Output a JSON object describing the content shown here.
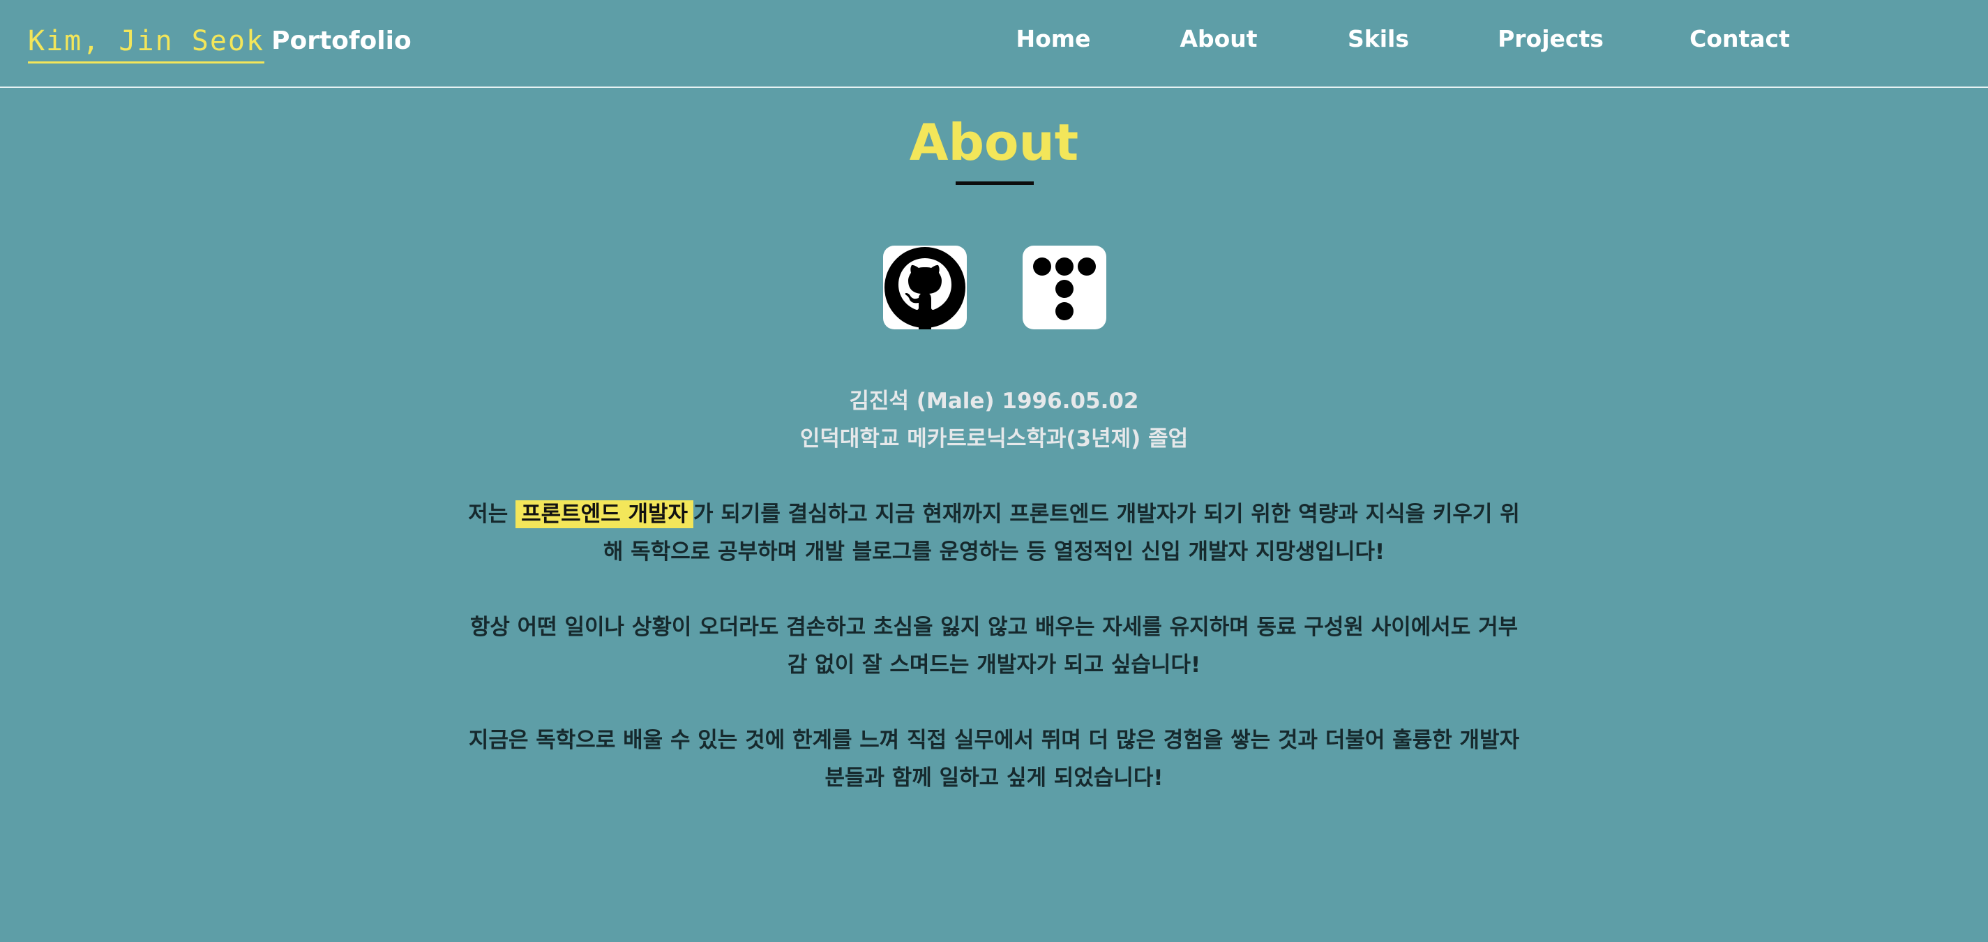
{
  "header": {
    "brand_name": "Kim, Jin Seok",
    "brand_sub": "Portofolio"
  },
  "nav": {
    "items": [
      {
        "label": "Home"
      },
      {
        "label": "About"
      },
      {
        "label": "Skils"
      },
      {
        "label": "Projects"
      },
      {
        "label": "Contact"
      }
    ]
  },
  "about": {
    "title": "About",
    "links": {
      "github_icon": "github-icon",
      "tistory_icon": "tistory-icon"
    },
    "profile_line1": "김진석 (Male) 1996.05.02",
    "profile_line2": "인덕대학교 메카트로닉스학과(3년제) 졸업",
    "para1_prefix": "저는 ",
    "para1_highlight": "프론트엔드 개발자",
    "para1_suffix": "가 되기를 결심하고 지금 현재까지 프론트엔드 개발자가 되기 위한 역량과 지식을 키우기 위해 독학으로 공부하며 개발 블로그를 운영하는 등 열정적인 신입 개발자 지망생입니다!",
    "para2": "항상 어떤 일이나 상황이 오더라도 겸손하고 초심을 잃지 않고 배우는 자세를 유지하며 동료 구성원 사이에서도 거부감 없이 잘 스며드는 개발자가 되고 싶습니다!",
    "para3": "지금은 독학으로 배울 수 있는 것에 한계를 느껴 직접 실무에서 뛰며 더 많은 경험을 쌓는 것과 더불어 훌륭한 개발자분들과 함께 일하고 싶게 되었습니다!"
  },
  "colors": {
    "background": "#5e9ea7",
    "accent": "#f3e65a",
    "text_dark": "#16292d"
  }
}
